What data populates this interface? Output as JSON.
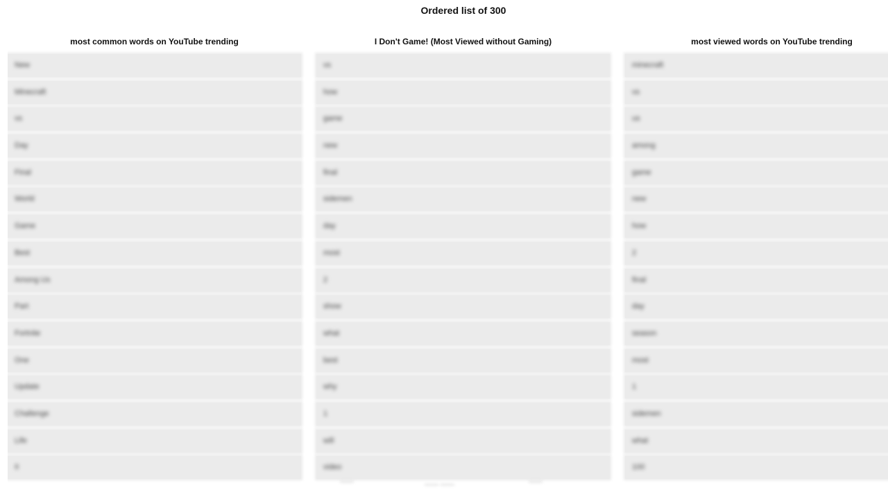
{
  "page": {
    "title": "Ordered list of 300"
  },
  "columns": [
    {
      "title": "most common words on YouTube trending",
      "items": [
        "New",
        "Minecraft",
        "vs",
        "Day",
        "Final",
        "World",
        "Game",
        "Best",
        "Among Us",
        "Part",
        "Fortnite",
        "One",
        "Update",
        "Challenge",
        "Life",
        "II"
      ]
    },
    {
      "title": "I Don't Game! (Most Viewed without Gaming)",
      "items": [
        "vs",
        "how",
        "game",
        "new",
        "final",
        "sidemen",
        "day",
        "most",
        "2",
        "show",
        "what",
        "best",
        "why",
        "1",
        "will",
        "video"
      ]
    },
    {
      "title": "most viewed words on YouTube trending",
      "items": [
        "minecraft",
        "vs",
        "us",
        "among",
        "game",
        "new",
        "how",
        "2",
        "final",
        "day",
        "season",
        "most",
        "1",
        "sidemen",
        "what",
        "100"
      ]
    }
  ],
  "footer": {
    "ghosts": [
      "——",
      "—— ——",
      "——"
    ]
  }
}
